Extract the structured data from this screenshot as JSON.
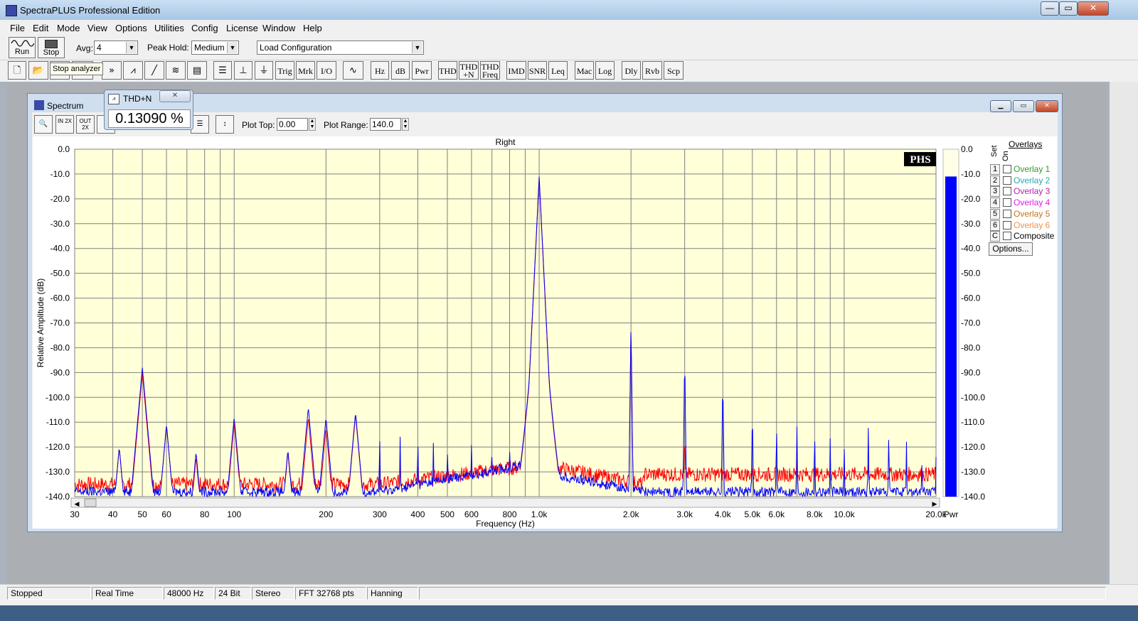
{
  "window": {
    "title": "SpectraPLUS Professional Edition",
    "minimize": "—",
    "maximize": "▭",
    "close": "✕"
  },
  "menu": [
    "File",
    "Edit",
    "Mode",
    "View",
    "Options",
    "Utilities",
    "Config",
    "License",
    "Window",
    "Help"
  ],
  "toolbar1": {
    "run_label": "Run",
    "stop_label": "Stop",
    "avg_label": "Avg:",
    "avg_value": "4",
    "peak_hold_label": "Peak Hold:",
    "peak_hold_value": "Medium",
    "config_value": "Load Configuration"
  },
  "tooltip": "Stop analyzer",
  "toolbar2": {
    "text_buttons": [
      "Trig",
      "Mrk",
      "I/O",
      "Hz",
      "dB",
      "Pwr",
      "THD",
      "THD +N",
      "THD Freq",
      "IMD",
      "SNR",
      "Leq",
      "Mac",
      "Log",
      "Dly",
      "Rvb",
      "Scp"
    ]
  },
  "spectrum_window": {
    "title": "Spectrum",
    "plot_top_label": "Plot Top:",
    "plot_top_value": "0.00",
    "plot_range_label": "Plot Range:",
    "plot_range_value": "140.0",
    "zoom_in_label": "IN 2X",
    "zoom_out_label": "OUT 2X"
  },
  "thd_window": {
    "title": "THD+N",
    "value": "0.13090 %",
    "close": "✕"
  },
  "overlays": {
    "title": "Overlays",
    "set_label": "Set",
    "on_label": "On",
    "items": [
      {
        "num": "1",
        "label": "Overlay 1",
        "color": "#2e9a2e"
      },
      {
        "num": "2",
        "label": "Overlay 2",
        "color": "#2aa7b0"
      },
      {
        "num": "3",
        "label": "Overlay 3",
        "color": "#b01fb0"
      },
      {
        "num": "4",
        "label": "Overlay 4",
        "color": "#e020e0"
      },
      {
        "num": "5",
        "label": "Overlay 5",
        "color": "#c0741e"
      },
      {
        "num": "6",
        "label": "Overlay 6",
        "color": "#f0904a"
      },
      {
        "num": "C",
        "label": "Composite",
        "color": "#000000"
      }
    ],
    "options_label": "Options..."
  },
  "chart_data": {
    "type": "line",
    "title": "Right",
    "xlabel": "Frequency (Hz)",
    "ylabel": "Relative Amplitude (dB)",
    "x_scale": "log",
    "xlim": [
      30,
      20000
    ],
    "ylim": [
      -140,
      0
    ],
    "grid": true,
    "background": "#ffffd8",
    "logo": "PHS",
    "x_tick_labels": [
      "30",
      "40",
      "50",
      "60",
      "80",
      "100",
      "200",
      "300",
      "400",
      "500",
      "600",
      "800",
      "1.0k",
      "2.0k",
      "3.0k",
      "4.0k",
      "5.0k",
      "6.0k",
      "8.0k",
      "10.0k",
      "20.0k"
    ],
    "x_tick_values": [
      30,
      40,
      50,
      60,
      80,
      100,
      200,
      300,
      400,
      500,
      600,
      800,
      1000,
      2000,
      3000,
      4000,
      5000,
      6000,
      8000,
      10000,
      20000
    ],
    "y_tick_labels": [
      "0.0",
      "-10.0",
      "-20.0",
      "-30.0",
      "-40.0",
      "-50.0",
      "-60.0",
      "-70.0",
      "-80.0",
      "-90.0",
      "-100.0",
      "-110.0",
      "-120.0",
      "-130.0",
      "-140.0"
    ],
    "y_tick_values": [
      0,
      -10,
      -20,
      -30,
      -40,
      -50,
      -60,
      -70,
      -80,
      -90,
      -100,
      -110,
      -120,
      -130,
      -140
    ],
    "series": [
      {
        "color": "#ff0000",
        "floor": -136,
        "peaks": [
          [
            42,
            -120
          ],
          [
            50,
            -90
          ],
          [
            60,
            -111
          ],
          [
            75,
            -124
          ],
          [
            100,
            -110
          ],
          [
            150,
            -122
          ],
          [
            175,
            -108
          ],
          [
            200,
            -112
          ],
          [
            250,
            -107
          ],
          [
            300,
            -123
          ],
          [
            350,
            -124
          ],
          [
            400,
            -122
          ],
          [
            500,
            -123
          ],
          [
            600,
            -124
          ],
          [
            700,
            -124
          ],
          [
            1000,
            -12
          ],
          [
            2000,
            -70
          ],
          [
            3000,
            -110
          ],
          [
            4000,
            -120
          ],
          [
            5000,
            -121
          ],
          [
            6000,
            -123
          ],
          [
            7000,
            -125
          ],
          [
            8000,
            -124
          ],
          [
            9000,
            -126
          ],
          [
            10000,
            -125
          ],
          [
            12000,
            -127
          ],
          [
            14000,
            -128
          ],
          [
            16000,
            -128
          ],
          [
            18000,
            -129
          ]
        ]
      },
      {
        "color": "#0000ff",
        "floor": -140,
        "peaks": [
          [
            42,
            -120
          ],
          [
            50,
            -88
          ],
          [
            60,
            -111
          ],
          [
            75,
            -122
          ],
          [
            100,
            -108
          ],
          [
            150,
            -121
          ],
          [
            175,
            -104
          ],
          [
            200,
            -108
          ],
          [
            250,
            -106
          ],
          [
            300,
            -113
          ],
          [
            350,
            -115
          ],
          [
            400,
            -114
          ],
          [
            450,
            -117
          ],
          [
            500,
            -118
          ],
          [
            600,
            -119
          ],
          [
            700,
            -120
          ],
          [
            800,
            -121
          ],
          [
            1000,
            -11
          ],
          [
            2000,
            -69
          ],
          [
            3000,
            -82
          ],
          [
            4000,
            -91
          ],
          [
            5000,
            -103
          ],
          [
            6000,
            -110
          ],
          [
            7000,
            -111
          ],
          [
            8000,
            -112
          ],
          [
            9000,
            -115
          ],
          [
            10000,
            -116
          ],
          [
            12000,
            -112
          ],
          [
            14000,
            -113
          ],
          [
            16000,
            -117
          ],
          [
            18000,
            -121
          ],
          [
            20000,
            -124
          ]
        ]
      }
    ],
    "pwr_bar": {
      "label": "Pwr",
      "value": -11,
      "color": "#0000ff"
    },
    "pwr_tick_labels": [
      "0.0",
      "-10.0",
      "-20.0",
      "-30.0",
      "-40.0",
      "-50.0",
      "-60.0",
      "-70.0",
      "-80.0",
      "-90.0",
      "-100.0",
      "-110.0",
      "-120.0",
      "-130.0",
      "-140.0"
    ]
  },
  "status": [
    "Stopped",
    "Real Time",
    "48000 Hz",
    "24 Bit",
    "Stereo",
    "FFT 32768 pts",
    "Hanning"
  ]
}
